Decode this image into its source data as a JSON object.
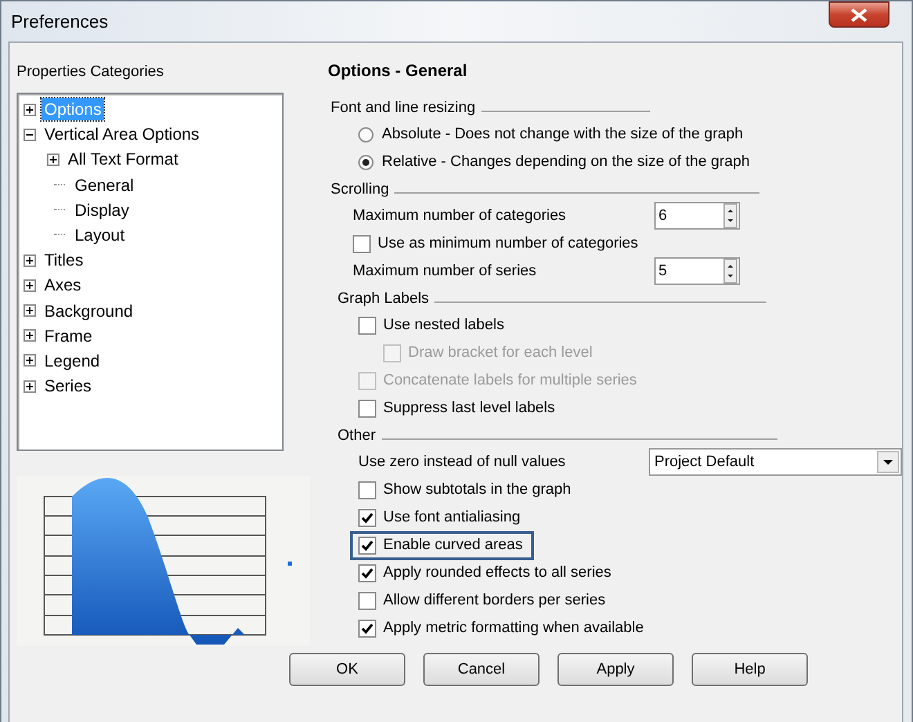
{
  "window": {
    "title": "Preferences"
  },
  "categories": {
    "title": "Properties Categories",
    "tree": [
      {
        "label": "Options",
        "expanded": false,
        "selected": true
      },
      {
        "label": "Vertical Area Options",
        "expanded": true,
        "selected": false,
        "children": [
          {
            "label": "All Text Format",
            "expanded": false,
            "selected": false
          },
          {
            "label": "General",
            "selected": false
          },
          {
            "label": "Display",
            "selected": false
          },
          {
            "label": "Layout",
            "selected": false
          }
        ]
      },
      {
        "label": "Titles",
        "expanded": false,
        "selected": false
      },
      {
        "label": "Axes",
        "expanded": false,
        "selected": false
      },
      {
        "label": "Background",
        "expanded": false,
        "selected": false
      },
      {
        "label": "Frame",
        "expanded": false,
        "selected": false
      },
      {
        "label": "Legend",
        "expanded": false,
        "selected": false
      },
      {
        "label": "Series",
        "expanded": false,
        "selected": false
      }
    ]
  },
  "panel": {
    "title": "Options - General",
    "sections": [
      {
        "title": "Font and line resizing",
        "rows": [
          {
            "kind": "radio",
            "label": "Absolute - Does not change with the size of the graph",
            "selected": false
          },
          {
            "kind": "radio",
            "label": "Relative - Changes depending on the size of the graph",
            "selected": true
          }
        ]
      },
      {
        "title": "Scrolling",
        "rows": [
          {
            "kind": "spin",
            "label": "Maximum number of categories",
            "value": "6"
          },
          {
            "kind": "checkbox",
            "label": "Use as minimum number of categories",
            "checked": false,
            "disabled": false,
            "highlighted": false
          },
          {
            "kind": "spin",
            "label": "Maximum number of series",
            "value": "5"
          }
        ]
      },
      {
        "title": "Graph Labels",
        "rows": [
          {
            "kind": "checkbox",
            "label": "Use nested labels",
            "checked": false,
            "disabled": false,
            "highlighted": false,
            "children": [
              {
                "kind": "checkbox",
                "label": "Draw bracket for each level",
                "checked": false,
                "disabled": true,
                "highlighted": false
              }
            ]
          },
          {
            "kind": "checkbox",
            "label": "Concatenate labels for multiple series",
            "checked": false,
            "disabled": true,
            "highlighted": false
          },
          {
            "kind": "checkbox",
            "label": "Suppress last level labels",
            "checked": false,
            "disabled": false,
            "highlighted": false
          }
        ]
      },
      {
        "title": "Other",
        "rows": [
          {
            "kind": "select",
            "label": "Use zero instead of null values",
            "value": "Project Default"
          },
          {
            "kind": "checkbox",
            "label": "Show subtotals in the graph",
            "checked": false,
            "disabled": false,
            "highlighted": false
          },
          {
            "kind": "checkbox",
            "label": "Use font antialiasing",
            "checked": true,
            "disabled": false,
            "highlighted": false
          },
          {
            "kind": "checkbox",
            "label": "Enable curved areas",
            "checked": true,
            "disabled": false,
            "highlighted": true
          },
          {
            "kind": "checkbox",
            "label": "Apply rounded effects to all series",
            "checked": true,
            "disabled": false,
            "highlighted": false
          },
          {
            "kind": "checkbox",
            "label": "Allow different borders per series",
            "checked": false,
            "disabled": false,
            "highlighted": false
          },
          {
            "kind": "checkbox",
            "label": "Apply metric formatting when available",
            "checked": true,
            "disabled": false,
            "highlighted": false
          }
        ]
      }
    ]
  },
  "buttons": [
    "OK",
    "Cancel",
    "Apply",
    "Help"
  ]
}
